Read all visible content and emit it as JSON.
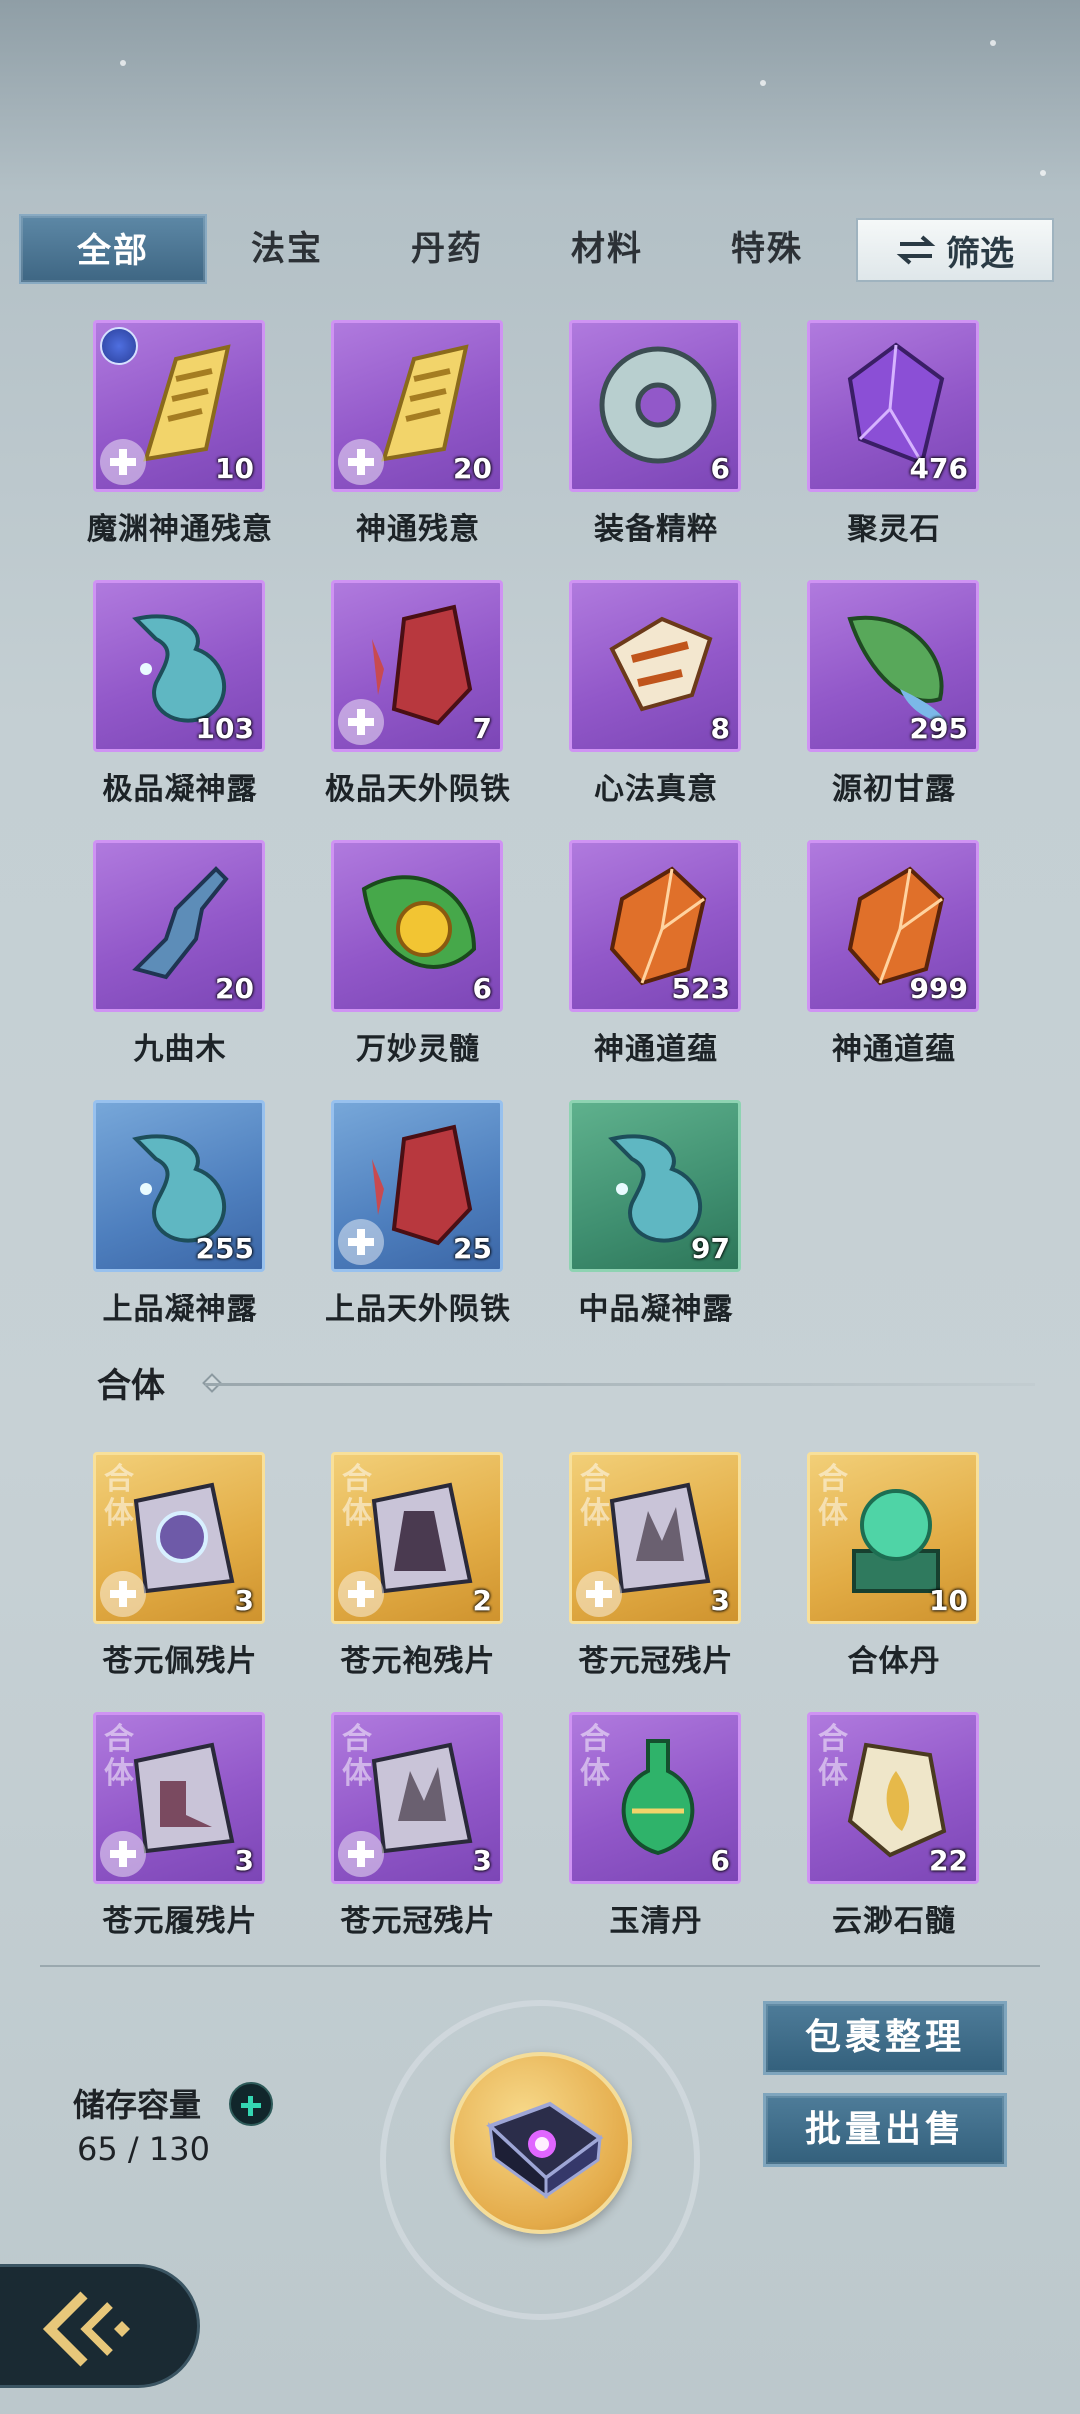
{
  "tabs": [
    {
      "label": "全部",
      "active": true
    },
    {
      "label": "法宝",
      "active": false
    },
    {
      "label": "丹药",
      "active": false
    },
    {
      "label": "材料",
      "active": false
    },
    {
      "label": "特殊",
      "active": false
    }
  ],
  "filter_label": "筛选",
  "items": [
    {
      "name": "魔渊神通残意",
      "count": "10",
      "rarity": "purple",
      "icon": "golden-scroll-icon",
      "badge": true,
      "plus": true
    },
    {
      "name": "神通残意",
      "count": "20",
      "rarity": "purple",
      "icon": "golden-scroll-icon",
      "plus": true
    },
    {
      "name": "装备精粹",
      "count": "6",
      "rarity": "purple",
      "icon": "jade-ring-icon"
    },
    {
      "name": "聚灵石",
      "count": "476",
      "rarity": "purple",
      "icon": "purple-crystal-icon"
    },
    {
      "name": "极品凝神露",
      "count": "103",
      "rarity": "purple",
      "icon": "dew-flask-icon"
    },
    {
      "name": "极品天外陨铁",
      "count": "7",
      "rarity": "purple",
      "icon": "red-meteor-iron-icon",
      "plus": true
    },
    {
      "name": "心法真意",
      "count": "8",
      "rarity": "purple",
      "icon": "golden-relic-icon"
    },
    {
      "name": "源初甘露",
      "count": "295",
      "rarity": "purple",
      "icon": "leaf-dew-icon"
    },
    {
      "name": "九曲木",
      "count": "20",
      "rarity": "purple",
      "icon": "twisted-wood-icon"
    },
    {
      "name": "万妙灵髓",
      "count": "6",
      "rarity": "purple",
      "icon": "leaf-gem-icon"
    },
    {
      "name": "神通道蕴",
      "count": "523",
      "rarity": "purple",
      "icon": "orange-crystal-icon"
    },
    {
      "name": "神通道蕴",
      "count": "999",
      "rarity": "purple",
      "icon": "orange-crystal-icon"
    },
    {
      "name": "上品凝神露",
      "count": "255",
      "rarity": "blue",
      "icon": "dew-flask-icon"
    },
    {
      "name": "上品天外陨铁",
      "count": "25",
      "rarity": "blue",
      "icon": "red-meteor-iron-icon",
      "plus": true
    },
    {
      "name": "中品凝神露",
      "count": "97",
      "rarity": "green",
      "icon": "dew-flask-icon"
    }
  ],
  "section_title": "合体",
  "section_items": [
    {
      "name": "苍元佩残片",
      "count": "3",
      "rarity": "gold",
      "stage": "合体",
      "icon": "pendant-fragment-icon",
      "plus": true
    },
    {
      "name": "苍元袍残片",
      "count": "2",
      "rarity": "gold",
      "stage": "合体",
      "icon": "robe-fragment-icon",
      "plus": true
    },
    {
      "name": "苍元冠残片",
      "count": "3",
      "rarity": "gold",
      "stage": "合体",
      "icon": "crown-fragment-icon",
      "plus": true
    },
    {
      "name": "合体丹",
      "count": "10",
      "rarity": "gold",
      "stage": "合体",
      "icon": "jade-orb-pill-icon"
    },
    {
      "name": "苍元履残片",
      "count": "3",
      "rarity": "purple",
      "stage": "合体",
      "icon": "boots-fragment-icon",
      "plus": true
    },
    {
      "name": "苍元冠残片",
      "count": "3",
      "rarity": "purple",
      "stage": "合体",
      "icon": "crown-fragment-icon",
      "plus": true
    },
    {
      "name": "玉清丹",
      "count": "6",
      "rarity": "purple",
      "stage": "合体",
      "icon": "green-potion-icon"
    },
    {
      "name": "云渺石髓",
      "count": "22",
      "rarity": "purple",
      "stage": "合体",
      "icon": "stone-marrow-icon"
    }
  ],
  "storage": {
    "label": "储存容量",
    "value": "65 / 130"
  },
  "buttons": {
    "organize": "包裹整理",
    "bulk_sell": "批量出售"
  },
  "colors": {
    "purple": "#9258c9",
    "blue": "#4e7fbe",
    "green": "#3f8f70",
    "gold": "#e2ac45",
    "tab_active": "#3e6683"
  }
}
